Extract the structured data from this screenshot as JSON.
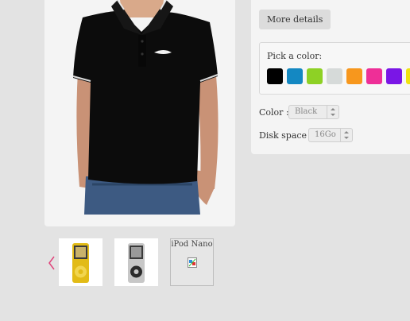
{
  "gallery": {
    "product_image": "black-polo-shirt-photo",
    "thumbnails": [
      {
        "image": "ipod-nano-yellow-thumbnail"
      },
      {
        "image": "ipod-nano-silver-thumbnail"
      },
      {
        "label": "iPod Nano",
        "image": "broken-image-icon"
      }
    ],
    "prev_icon": "chevron-left-icon",
    "accent_color": "#e0457b"
  },
  "details": {
    "more_details_label": "More details",
    "pick_color_label": "Pick a color:",
    "swatches": [
      {
        "name": "black",
        "color": "#000000"
      },
      {
        "name": "blue",
        "color": "#1488c2"
      },
      {
        "name": "green",
        "color": "#8ed125"
      },
      {
        "name": "light-gray",
        "color": "#d6dad9"
      },
      {
        "name": "orange",
        "color": "#f7971d"
      },
      {
        "name": "pink",
        "color": "#ee2f97"
      },
      {
        "name": "purple",
        "color": "#7a16e6"
      },
      {
        "name": "yellow",
        "color": "#f0e311"
      }
    ],
    "color_label": "Color :",
    "color_value": "Black",
    "disk_label": "Disk space :",
    "disk_value": "16Go"
  }
}
